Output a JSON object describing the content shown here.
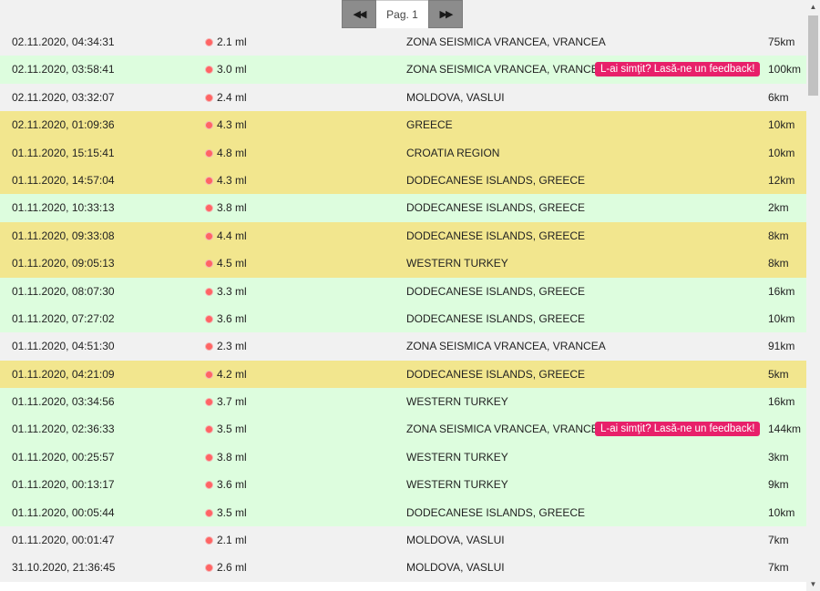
{
  "pager": {
    "prev_icon": "double-chevron-left-icon",
    "prev_glyph": "◀◀",
    "label": "Pag. 1",
    "next_icon": "double-chevron-right-icon",
    "next_glyph": "▶▶"
  },
  "feedback_label": "L-ai simţit? Lasă-ne un feedback!",
  "colors": {
    "low": "#f1f1f1",
    "mid": "#ddfdde",
    "high": "#f2e68e",
    "feedback": "#e8206a",
    "magnitude_dot": "#ff6464"
  },
  "quakes": [
    {
      "date": "02.11.2020, 04:34:31",
      "mag": "2.1 ml",
      "loc": "ZONA SEISMICA VRANCEA, VRANCEA",
      "dist": "75km",
      "level": "low",
      "feedback": false
    },
    {
      "date": "02.11.2020, 03:58:41",
      "mag": "3.0 ml",
      "loc": "ZONA SEISMICA VRANCEA, VRANCEA",
      "dist": "100km",
      "level": "mid",
      "feedback": true
    },
    {
      "date": "02.11.2020, 03:32:07",
      "mag": "2.4 ml",
      "loc": "MOLDOVA, VASLUI",
      "dist": "6km",
      "level": "low",
      "feedback": false
    },
    {
      "date": "02.11.2020, 01:09:36",
      "mag": "4.3 ml",
      "loc": "GREECE",
      "dist": "10km",
      "level": "high",
      "feedback": false
    },
    {
      "date": "01.11.2020, 15:15:41",
      "mag": "4.8 ml",
      "loc": "CROATIA REGION",
      "dist": "10km",
      "level": "high",
      "feedback": false
    },
    {
      "date": "01.11.2020, 14:57:04",
      "mag": "4.3 ml",
      "loc": "DODECANESE ISLANDS, GREECE",
      "dist": "12km",
      "level": "high",
      "feedback": false
    },
    {
      "date": "01.11.2020, 10:33:13",
      "mag": "3.8 ml",
      "loc": "DODECANESE ISLANDS, GREECE",
      "dist": "2km",
      "level": "mid",
      "feedback": false
    },
    {
      "date": "01.11.2020, 09:33:08",
      "mag": "4.4 ml",
      "loc": "DODECANESE ISLANDS, GREECE",
      "dist": "8km",
      "level": "high",
      "feedback": false
    },
    {
      "date": "01.11.2020, 09:05:13",
      "mag": "4.5 ml",
      "loc": "WESTERN TURKEY",
      "dist": "8km",
      "level": "high",
      "feedback": false
    },
    {
      "date": "01.11.2020, 08:07:30",
      "mag": "3.3 ml",
      "loc": "DODECANESE ISLANDS, GREECE",
      "dist": "16km",
      "level": "mid",
      "feedback": false
    },
    {
      "date": "01.11.2020, 07:27:02",
      "mag": "3.6 ml",
      "loc": "DODECANESE ISLANDS, GREECE",
      "dist": "10km",
      "level": "mid",
      "feedback": false
    },
    {
      "date": "01.11.2020, 04:51:30",
      "mag": "2.3 ml",
      "loc": "ZONA SEISMICA VRANCEA, VRANCEA",
      "dist": "91km",
      "level": "low",
      "feedback": false
    },
    {
      "date": "01.11.2020, 04:21:09",
      "mag": "4.2 ml",
      "loc": "DODECANESE ISLANDS, GREECE",
      "dist": "5km",
      "level": "high",
      "feedback": false
    },
    {
      "date": "01.11.2020, 03:34:56",
      "mag": "3.7 ml",
      "loc": "WESTERN TURKEY",
      "dist": "16km",
      "level": "mid",
      "feedback": false
    },
    {
      "date": "01.11.2020, 02:36:33",
      "mag": "3.5 ml",
      "loc": "ZONA SEISMICA VRANCEA, VRANCEA",
      "dist": "144km",
      "level": "mid",
      "feedback": true
    },
    {
      "date": "01.11.2020, 00:25:57",
      "mag": "3.8 ml",
      "loc": "WESTERN TURKEY",
      "dist": "3km",
      "level": "mid",
      "feedback": false
    },
    {
      "date": "01.11.2020, 00:13:17",
      "mag": "3.6 ml",
      "loc": "WESTERN TURKEY",
      "dist": "9km",
      "level": "mid",
      "feedback": false
    },
    {
      "date": "01.11.2020, 00:05:44",
      "mag": "3.5 ml",
      "loc": "DODECANESE ISLANDS, GREECE",
      "dist": "10km",
      "level": "mid",
      "feedback": false
    },
    {
      "date": "01.11.2020, 00:01:47",
      "mag": "2.1 ml",
      "loc": "MOLDOVA, VASLUI",
      "dist": "7km",
      "level": "low",
      "feedback": false
    },
    {
      "date": "31.10.2020, 21:36:45",
      "mag": "2.6 ml",
      "loc": "MOLDOVA, VASLUI",
      "dist": "7km",
      "level": "low",
      "feedback": false
    }
  ]
}
